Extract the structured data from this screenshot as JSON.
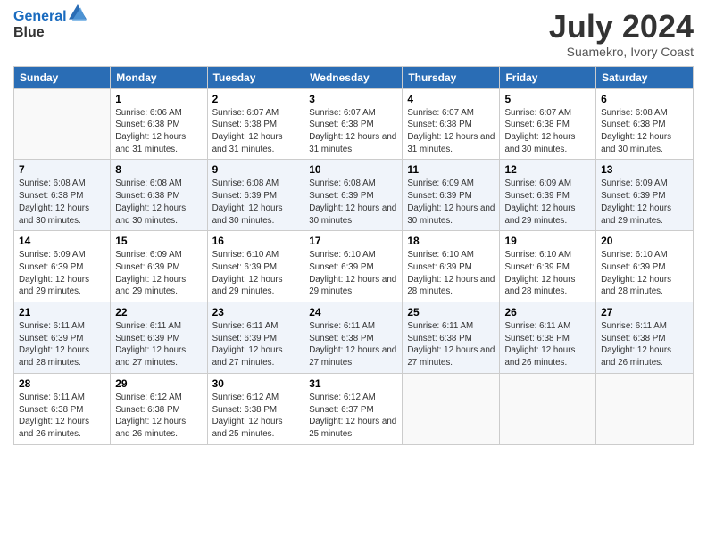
{
  "header": {
    "logo_line1": "General",
    "logo_line2": "Blue",
    "title": "July 2024",
    "subtitle": "Suamekro, Ivory Coast"
  },
  "calendar": {
    "days_of_week": [
      "Sunday",
      "Monday",
      "Tuesday",
      "Wednesday",
      "Thursday",
      "Friday",
      "Saturday"
    ],
    "weeks": [
      [
        {
          "day": "",
          "info": ""
        },
        {
          "day": "1",
          "info": "Sunrise: 6:06 AM\nSunset: 6:38 PM\nDaylight: 12 hours and 31 minutes."
        },
        {
          "day": "2",
          "info": "Sunrise: 6:07 AM\nSunset: 6:38 PM\nDaylight: 12 hours and 31 minutes."
        },
        {
          "day": "3",
          "info": "Sunrise: 6:07 AM\nSunset: 6:38 PM\nDaylight: 12 hours and 31 minutes."
        },
        {
          "day": "4",
          "info": "Sunrise: 6:07 AM\nSunset: 6:38 PM\nDaylight: 12 hours and 31 minutes."
        },
        {
          "day": "5",
          "info": "Sunrise: 6:07 AM\nSunset: 6:38 PM\nDaylight: 12 hours and 30 minutes."
        },
        {
          "day": "6",
          "info": "Sunrise: 6:08 AM\nSunset: 6:38 PM\nDaylight: 12 hours and 30 minutes."
        }
      ],
      [
        {
          "day": "7",
          "info": "Sunrise: 6:08 AM\nSunset: 6:38 PM\nDaylight: 12 hours and 30 minutes."
        },
        {
          "day": "8",
          "info": "Sunrise: 6:08 AM\nSunset: 6:38 PM\nDaylight: 12 hours and 30 minutes."
        },
        {
          "day": "9",
          "info": "Sunrise: 6:08 AM\nSunset: 6:39 PM\nDaylight: 12 hours and 30 minutes."
        },
        {
          "day": "10",
          "info": "Sunrise: 6:08 AM\nSunset: 6:39 PM\nDaylight: 12 hours and 30 minutes."
        },
        {
          "day": "11",
          "info": "Sunrise: 6:09 AM\nSunset: 6:39 PM\nDaylight: 12 hours and 30 minutes."
        },
        {
          "day": "12",
          "info": "Sunrise: 6:09 AM\nSunset: 6:39 PM\nDaylight: 12 hours and 29 minutes."
        },
        {
          "day": "13",
          "info": "Sunrise: 6:09 AM\nSunset: 6:39 PM\nDaylight: 12 hours and 29 minutes."
        }
      ],
      [
        {
          "day": "14",
          "info": "Sunrise: 6:09 AM\nSunset: 6:39 PM\nDaylight: 12 hours and 29 minutes."
        },
        {
          "day": "15",
          "info": "Sunrise: 6:09 AM\nSunset: 6:39 PM\nDaylight: 12 hours and 29 minutes."
        },
        {
          "day": "16",
          "info": "Sunrise: 6:10 AM\nSunset: 6:39 PM\nDaylight: 12 hours and 29 minutes."
        },
        {
          "day": "17",
          "info": "Sunrise: 6:10 AM\nSunset: 6:39 PM\nDaylight: 12 hours and 29 minutes."
        },
        {
          "day": "18",
          "info": "Sunrise: 6:10 AM\nSunset: 6:39 PM\nDaylight: 12 hours and 28 minutes."
        },
        {
          "day": "19",
          "info": "Sunrise: 6:10 AM\nSunset: 6:39 PM\nDaylight: 12 hours and 28 minutes."
        },
        {
          "day": "20",
          "info": "Sunrise: 6:10 AM\nSunset: 6:39 PM\nDaylight: 12 hours and 28 minutes."
        }
      ],
      [
        {
          "day": "21",
          "info": "Sunrise: 6:11 AM\nSunset: 6:39 PM\nDaylight: 12 hours and 28 minutes."
        },
        {
          "day": "22",
          "info": "Sunrise: 6:11 AM\nSunset: 6:39 PM\nDaylight: 12 hours and 27 minutes."
        },
        {
          "day": "23",
          "info": "Sunrise: 6:11 AM\nSunset: 6:39 PM\nDaylight: 12 hours and 27 minutes."
        },
        {
          "day": "24",
          "info": "Sunrise: 6:11 AM\nSunset: 6:38 PM\nDaylight: 12 hours and 27 minutes."
        },
        {
          "day": "25",
          "info": "Sunrise: 6:11 AM\nSunset: 6:38 PM\nDaylight: 12 hours and 27 minutes."
        },
        {
          "day": "26",
          "info": "Sunrise: 6:11 AM\nSunset: 6:38 PM\nDaylight: 12 hours and 26 minutes."
        },
        {
          "day": "27",
          "info": "Sunrise: 6:11 AM\nSunset: 6:38 PM\nDaylight: 12 hours and 26 minutes."
        }
      ],
      [
        {
          "day": "28",
          "info": "Sunrise: 6:11 AM\nSunset: 6:38 PM\nDaylight: 12 hours and 26 minutes."
        },
        {
          "day": "29",
          "info": "Sunrise: 6:12 AM\nSunset: 6:38 PM\nDaylight: 12 hours and 26 minutes."
        },
        {
          "day": "30",
          "info": "Sunrise: 6:12 AM\nSunset: 6:38 PM\nDaylight: 12 hours and 25 minutes."
        },
        {
          "day": "31",
          "info": "Sunrise: 6:12 AM\nSunset: 6:37 PM\nDaylight: 12 hours and 25 minutes."
        },
        {
          "day": "",
          "info": ""
        },
        {
          "day": "",
          "info": ""
        },
        {
          "day": "",
          "info": ""
        }
      ]
    ]
  }
}
